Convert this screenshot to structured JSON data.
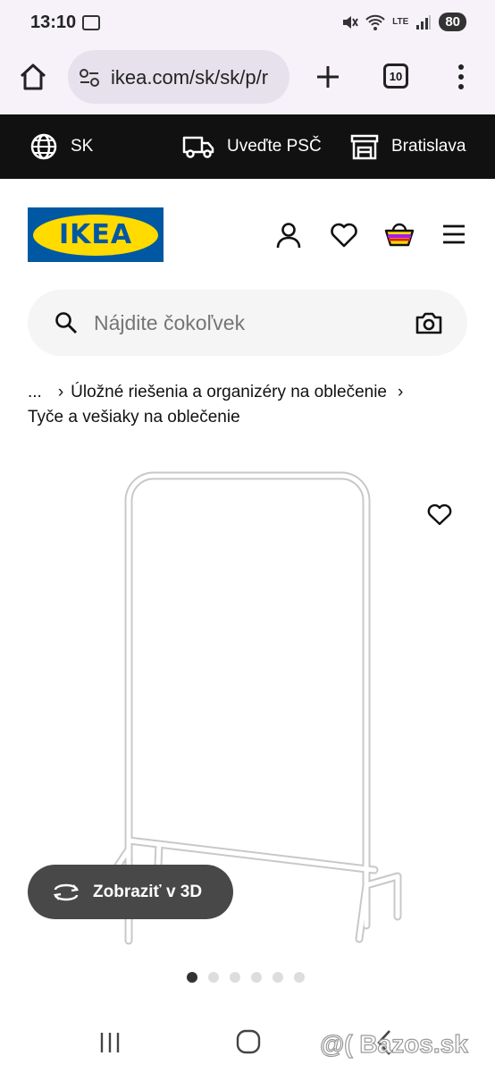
{
  "status": {
    "time": "13:10",
    "battery": "80",
    "network": "LTE"
  },
  "browser": {
    "url": "ikea.com/sk/sk/p/r",
    "tab_count": "10"
  },
  "utility": {
    "language": "SK",
    "postal_code": "Uveďte PSČ",
    "store": "Bratislava"
  },
  "header": {
    "logo": "IKEA"
  },
  "search": {
    "placeholder": "Nájdite čokoľvek"
  },
  "breadcrumb": {
    "ellipsis": "...",
    "category": "Úložné riešenia a organizéry na oblečenie",
    "subcategory": "Tyče a vešiaky na oblečenie"
  },
  "product": {
    "view_3d_label": "Zobraziť v 3D",
    "image_count": 6,
    "active_image": 1
  },
  "watermark": "@( Bazos.sk",
  "colors": {
    "brand_blue": "#0058a3",
    "brand_yellow": "#ffdb00",
    "utility_bar": "#111111",
    "button_dark": "#484848"
  }
}
